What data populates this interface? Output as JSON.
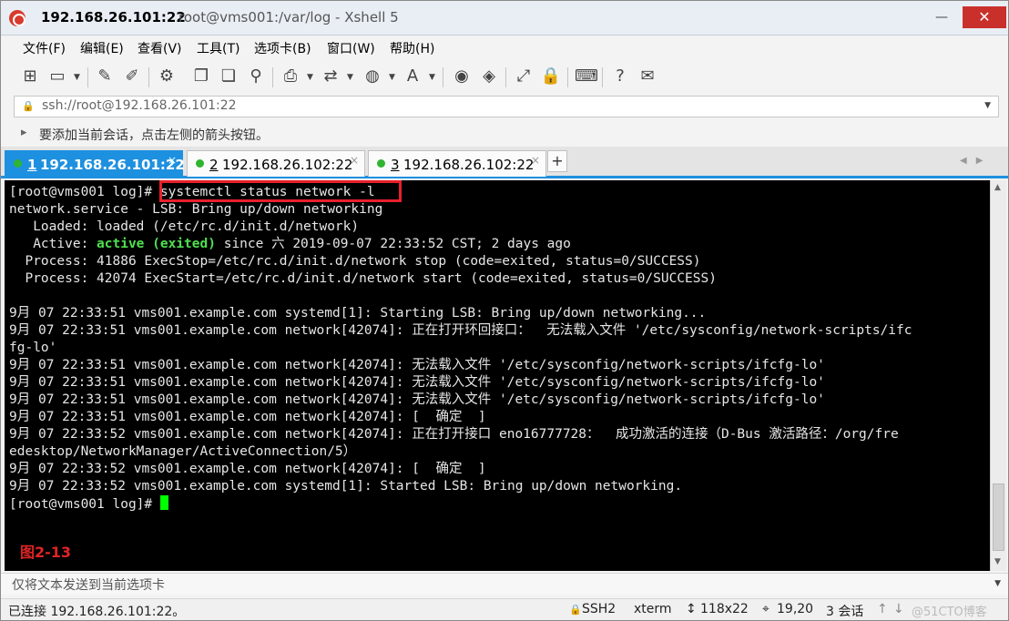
{
  "window": {
    "title_host": "192.168.26.101:22",
    "title_rest": "root@vms001:/var/log - Xshell 5",
    "minimize": "—",
    "maximize": "□",
    "close": "✕"
  },
  "menu": [
    "文件(F)",
    "编辑(E)",
    "查看(V)",
    "工具(T)",
    "选项卡(B)",
    "窗口(W)",
    "帮助(H)"
  ],
  "address": {
    "value": "ssh://root@192.168.26.101:22"
  },
  "hint": {
    "text": "要添加当前会话，点击左侧的箭头按钮。"
  },
  "tabs": [
    {
      "num": "1",
      "label": "192.168.26.101:22",
      "active": true
    },
    {
      "num": "2",
      "label": "192.168.26.102:22",
      "active": false
    },
    {
      "num": "3",
      "label": "192.168.26.102:22",
      "active": false
    }
  ],
  "tab_close": "×",
  "tab_add": "+",
  "tab_nav": "◀▶",
  "terminal": {
    "lines": [
      "[root@vms001 log]# systemctl status network -l",
      "network.service - LSB: Bring up/down networking",
      "   Loaded: loaded (/etc/rc.d/init.d/network)",
      "   Active: |active (exited)| since 六 2019-09-07 22:33:52 CST; 2 days ago",
      "  Process: 41886 ExecStop=/etc/rc.d/init.d/network stop (code=exited, status=0/SUCCESS)",
      "  Process: 42074 ExecStart=/etc/rc.d/init.d/network start (code=exited, status=0/SUCCESS)",
      "",
      "9月 07 22:33:51 vms001.example.com systemd[1]: Starting LSB: Bring up/down networking...",
      "9月 07 22:33:51 vms001.example.com network[42074]: 正在打开环回接口：  无法载入文件 '/etc/sysconfig/network-scripts/ifc",
      "fg-lo'",
      "9月 07 22:33:51 vms001.example.com network[42074]: 无法载入文件 '/etc/sysconfig/network-scripts/ifcfg-lo'",
      "9月 07 22:33:51 vms001.example.com network[42074]: 无法载入文件 '/etc/sysconfig/network-scripts/ifcfg-lo'",
      "9月 07 22:33:51 vms001.example.com network[42074]: 无法载入文件 '/etc/sysconfig/network-scripts/ifcfg-lo'",
      "9月 07 22:33:51 vms001.example.com network[42074]: [  确定  ]",
      "9月 07 22:33:52 vms001.example.com network[42074]: 正在打开接口 eno16777728：  成功激活的连接（D-Bus 激活路径：/org/fre",
      "edesktop/NetworkManager/ActiveConnection/5）",
      "9月 07 22:33:52 vms001.example.com network[42074]: [  确定  ]",
      "9月 07 22:33:52 vms001.example.com systemd[1]: Started LSB: Bring up/down networking.",
      "[root@vms001 log]# "
    ],
    "figure_label": "图2-13"
  },
  "send_bar": {
    "text": "仅将文本发送到当前选项卡"
  },
  "status": {
    "connection": "已连接 192.168.26.101:22。",
    "protocol": "SSH2",
    "term": "xterm",
    "size": "118x22",
    "cursor_pos": "19,20",
    "sessions": "3 会话",
    "watermark": "@51CTO博客"
  },
  "colors": {
    "tab_active": "#1e90e0",
    "terminal_bg": "#000000",
    "active_text": "#4fe04f",
    "highlight_box": "#e8202c",
    "figure_label": "#e02424"
  }
}
